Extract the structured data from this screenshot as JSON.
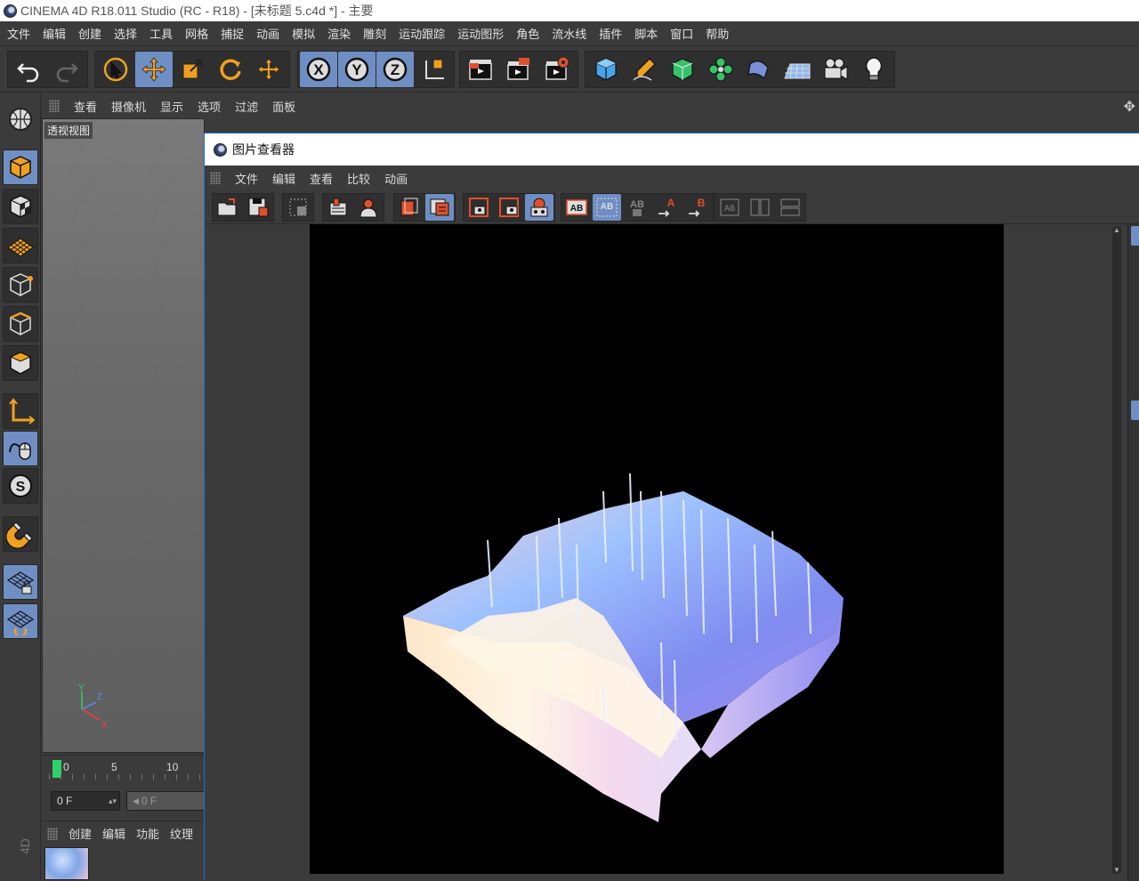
{
  "app": {
    "title": "CINEMA 4D R18.011 Studio (RC - R18) - [未标题 5.c4d *] - 主要",
    "logo_icon": "cinema4d-logo-icon"
  },
  "menubar": {
    "items": [
      "文件",
      "编辑",
      "创建",
      "选择",
      "工具",
      "网格",
      "捕捉",
      "动画",
      "模拟",
      "渲染",
      "雕刻",
      "运动跟踪",
      "运动图形",
      "角色",
      "流水线",
      "插件",
      "脚本",
      "窗口",
      "帮助"
    ]
  },
  "viewport": {
    "menu": [
      "查看",
      "摄像机",
      "显示",
      "选项",
      "过滤",
      "面板"
    ],
    "label": "透视视图",
    "axis": {
      "y": "Y",
      "z": "Z",
      "x": "X"
    }
  },
  "timeline": {
    "ticks": [
      "0",
      "5",
      "10"
    ],
    "current_frame": "0 F",
    "start_frame": "0 F"
  },
  "material_manager": {
    "menu": [
      "创建",
      "编辑",
      "功能",
      "纹理"
    ],
    "vertical_label": "4D"
  },
  "picture_viewer": {
    "title": "图片查看器",
    "menu": [
      "文件",
      "编辑",
      "查看",
      "比较",
      "动画"
    ],
    "ab_labels": {
      "ab": "AB",
      "a": "A",
      "b": "B"
    }
  },
  "colors": {
    "accent_blue": "#6f8fc4",
    "orange": "#f0a020",
    "window_border": "#1f6fd1",
    "timeline_marker": "#2fd06a"
  }
}
